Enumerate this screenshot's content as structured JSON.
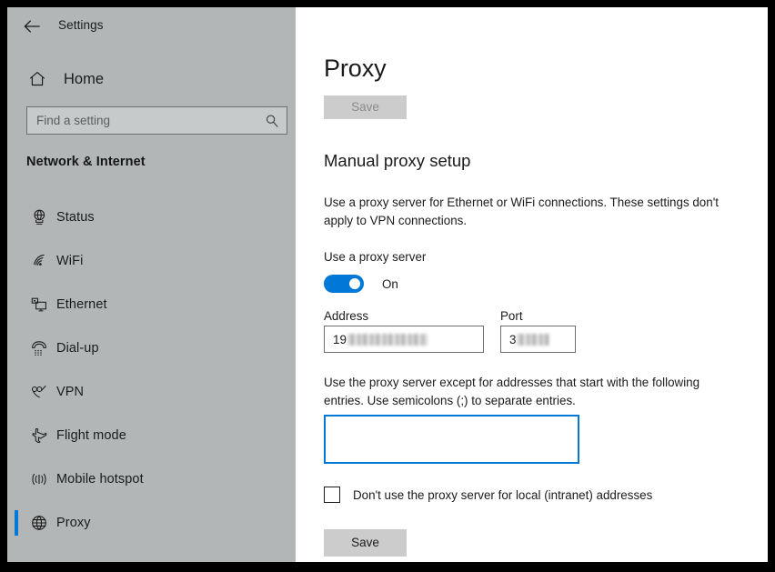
{
  "window": {
    "app_title": "Settings",
    "back_icon": "back-arrow-icon"
  },
  "sidebar": {
    "home": {
      "label": "Home",
      "icon": "home-icon"
    },
    "search": {
      "placeholder": "Find a setting",
      "value": "",
      "icon": "search-icon"
    },
    "category_title": "Network & Internet",
    "accent_color": "#0078d7",
    "background_color": "#b2b6b6",
    "items": [
      {
        "label": "Status",
        "icon": "network-status-icon",
        "selected": false
      },
      {
        "label": "WiFi",
        "icon": "wifi-icon",
        "selected": false
      },
      {
        "label": "Ethernet",
        "icon": "ethernet-icon",
        "selected": false
      },
      {
        "label": "Dial-up",
        "icon": "dialup-phone-icon",
        "selected": false
      },
      {
        "label": "VPN",
        "icon": "vpn-icon",
        "selected": false
      },
      {
        "label": "Flight mode",
        "icon": "airplane-icon",
        "selected": false
      },
      {
        "label": "Mobile hotspot",
        "icon": "hotspot-icon",
        "selected": false
      },
      {
        "label": "Proxy",
        "icon": "globe-icon",
        "selected": true
      }
    ]
  },
  "main": {
    "page_title": "Proxy",
    "save_top": {
      "label": "Save",
      "enabled": false
    },
    "section_title": "Manual proxy setup",
    "section_description": "Use a proxy server for Ethernet or WiFi connections. These settings don't apply to VPN connections.",
    "proxy_toggle": {
      "label": "Use a proxy server",
      "state_text": "On",
      "checked": true,
      "on_color": "#0078d7"
    },
    "address": {
      "label": "Address",
      "value": "19",
      "value_redacted": true
    },
    "port": {
      "label": "Port",
      "value": "3",
      "value_redacted": true
    },
    "exceptions": {
      "description": "Use the proxy server except for addresses that start with the following entries. Use semicolons (;) to separate entries.",
      "value": "",
      "focused": true,
      "focus_color": "#0078d7"
    },
    "local_bypass": {
      "label": "Don't use the proxy server for local (intranet) addresses",
      "checked": false
    },
    "save_bottom": {
      "label": "Save",
      "enabled": true
    }
  }
}
